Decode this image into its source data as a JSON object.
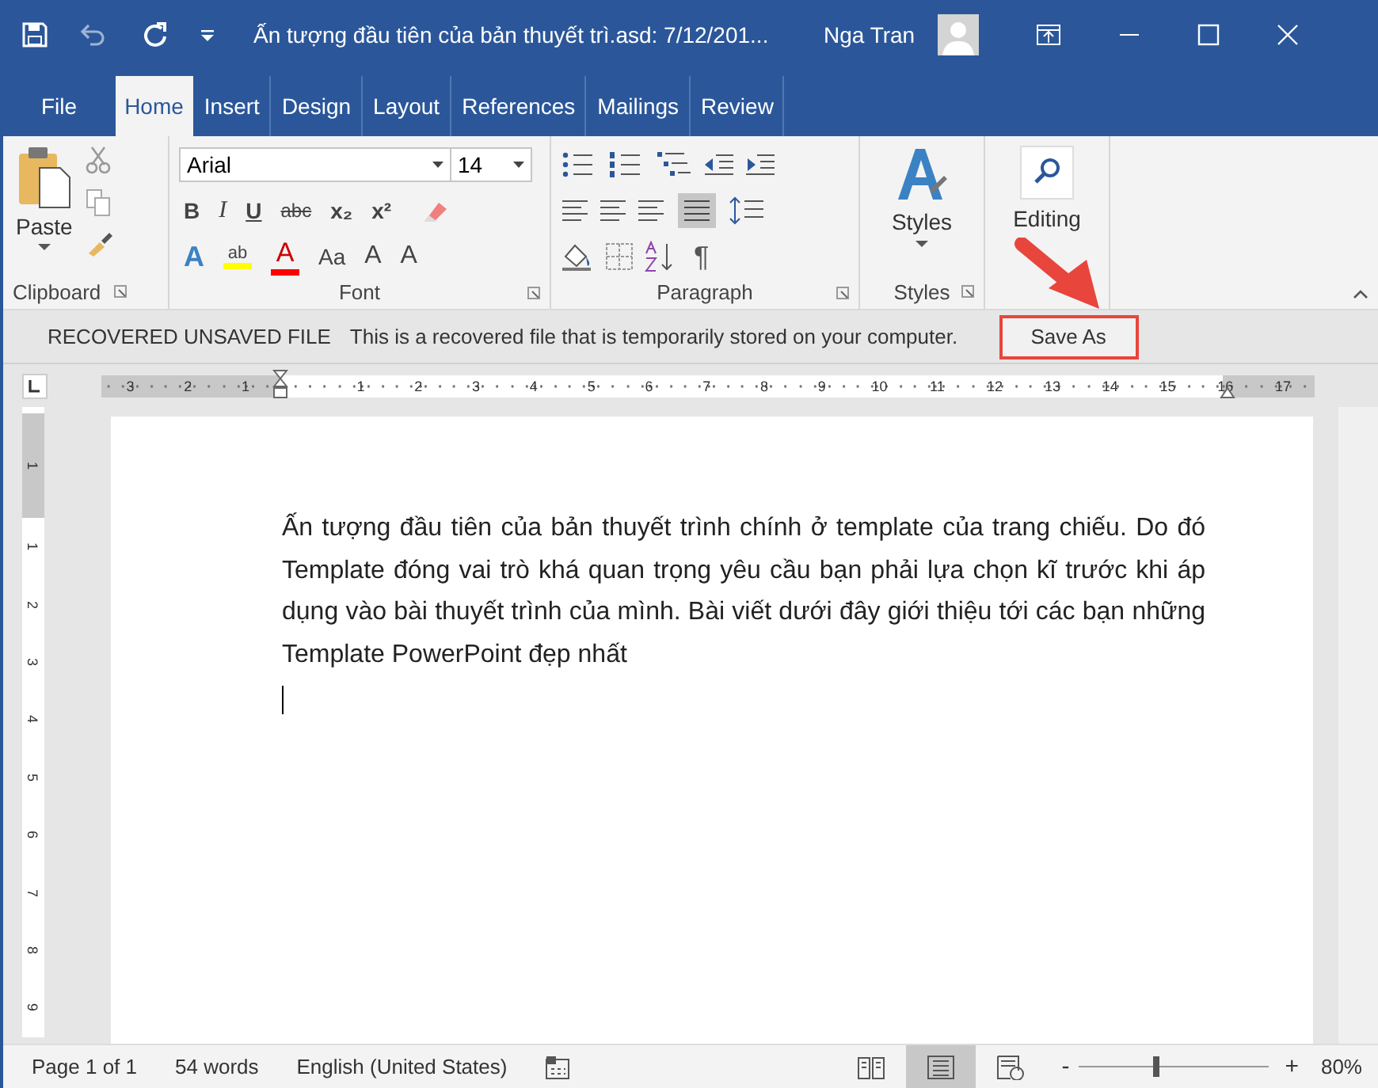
{
  "title_bar": {
    "title": "Ấn tượng đầu tiên của bản thuyết trì.asd: 7/12/201...",
    "user": "Nga Tran"
  },
  "tabs": [
    {
      "label": "File",
      "selected": false
    },
    {
      "label": "Home",
      "selected": true
    },
    {
      "label": "Insert",
      "selected": false
    },
    {
      "label": "Design",
      "selected": false
    },
    {
      "label": "Layout",
      "selected": false
    },
    {
      "label": "References",
      "selected": false
    },
    {
      "label": "Mailings",
      "selected": false
    },
    {
      "label": "Review",
      "selected": false
    }
  ],
  "ribbon": {
    "clipboard": {
      "label": "Clipboard",
      "paste": "Paste"
    },
    "font": {
      "label": "Font",
      "font_name": "Arial",
      "font_size": "14",
      "format_buttons": [
        {
          "kind": "bold",
          "text": "B"
        },
        {
          "kind": "italic",
          "text": "I"
        },
        {
          "kind": "underline",
          "text": "U"
        },
        {
          "kind": "strike",
          "text": "abc"
        },
        {
          "kind": "sub",
          "text": "x₂"
        },
        {
          "kind": "sup",
          "text": "x²"
        }
      ],
      "effect_buttons": [
        {
          "kind": "effects",
          "text": "A"
        },
        {
          "kind": "highlight",
          "text": "ab",
          "color": "#ffff00"
        },
        {
          "kind": "color",
          "text": "A",
          "color": "#ff0000"
        },
        {
          "kind": "case",
          "text": "Aa"
        },
        {
          "kind": "grow",
          "text": "A"
        },
        {
          "kind": "shrink",
          "text": "A"
        }
      ]
    },
    "paragraph": {
      "label": "Paragraph",
      "pilcrow": "¶"
    },
    "styles": {
      "label": "Styles",
      "button": "Styles"
    },
    "editing": {
      "button": "Editing"
    }
  },
  "info_bar": {
    "title": "RECOVERED UNSAVED FILE",
    "message": "This is a recovered file that is temporarily stored on your computer.",
    "button": "Save As"
  },
  "ruler": {
    "horizontal": [
      "3",
      "2",
      "1",
      "1",
      "2",
      "3",
      "4",
      "5",
      "6",
      "7",
      "8",
      "9",
      "10",
      "11",
      "12",
      "13",
      "14",
      "15",
      "16",
      "17"
    ],
    "vertical": [
      "1",
      "1",
      "2",
      "3",
      "4",
      "5",
      "6",
      "7",
      "8",
      "9"
    ]
  },
  "document": {
    "paragraph": "Ấn tượng đầu tiên của bản thuyết trình chính ở template của trang chiếu. Do đó Template đóng vai trò khá quan trọng yêu cầu bạn phải lựa chọn kĩ trước khi áp dụng vào bài thuyết trình của mình. Bài viết dưới đây giới thiệu tới các bạn những Template PowerPoint đẹp nhất"
  },
  "status_bar": {
    "page": "Page 1 of 1",
    "words": "54 words",
    "language": "English (United States)",
    "views": [
      {
        "kind": "read",
        "selected": false
      },
      {
        "kind": "print",
        "selected": true
      },
      {
        "kind": "web",
        "selected": false
      }
    ],
    "zoom_out": "-",
    "zoom_in": "+",
    "level": 0.39,
    "zoom": "80%"
  }
}
